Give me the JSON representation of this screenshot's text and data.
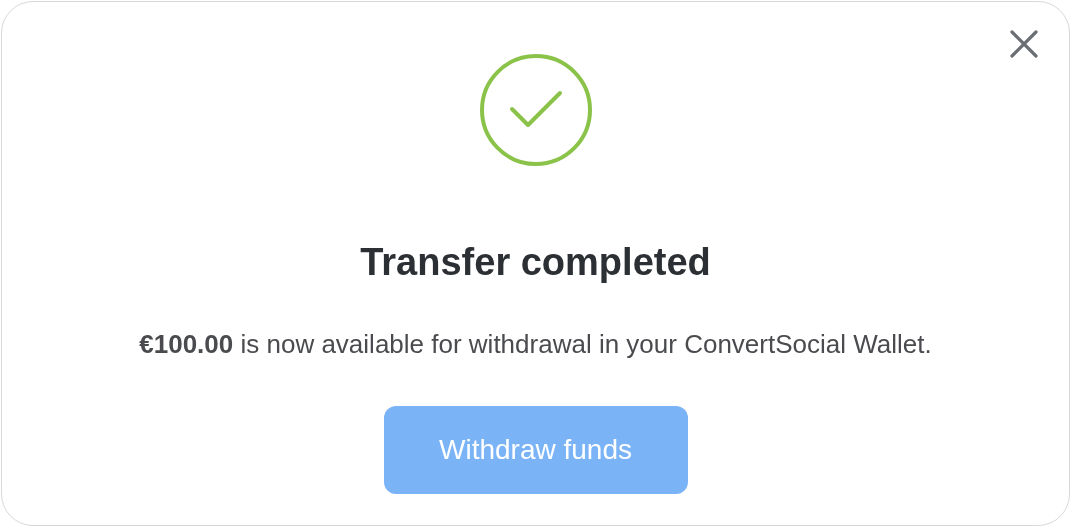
{
  "dialog": {
    "title": "Transfer completed",
    "message": "**€100.00** is now available for withdrawal in your ConvertSocial Wallet.",
    "button": "Withdraw funds"
  }
}
